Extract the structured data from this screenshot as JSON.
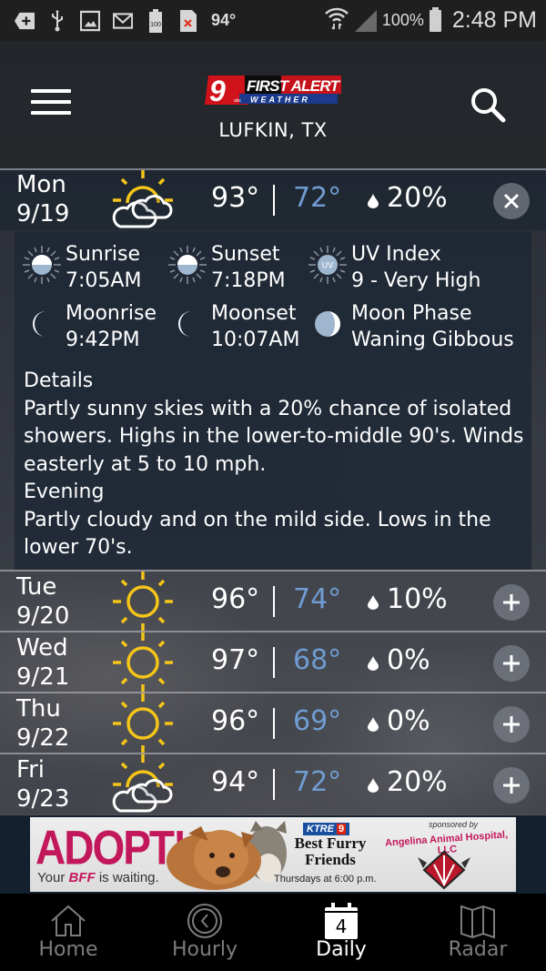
{
  "status_bar": {
    "notification_icons": [
      "add-icon",
      "usb-icon",
      "gallery-icon",
      "gmail-icon",
      "battery-100-icon",
      "sim-error-icon"
    ],
    "temperature": "94°",
    "battery_percent": "100%",
    "time": "2:48 PM"
  },
  "header": {
    "logo": {
      "number": "9",
      "line1": "FIRST ALERT",
      "line2": "WEATHER",
      "network": "abc"
    },
    "location": "LUFKIN, TX",
    "menu_icon": "hamburger-menu-icon",
    "search_icon": "search-icon"
  },
  "colors": {
    "low_temp": "#6f9cd1",
    "sun": "#f5c518",
    "accent_ad": "#c2185b"
  },
  "days": [
    {
      "day": "Mon",
      "date": "9/19",
      "icon": "partly-cloudy-icon",
      "high": "93°",
      "low": "72°",
      "precip": "20%",
      "expanded": true,
      "toggle": "close-icon"
    },
    {
      "day": "Tue",
      "date": "9/20",
      "icon": "sunny-icon",
      "high": "96°",
      "low": "74°",
      "precip": "10%",
      "expanded": false,
      "toggle": "plus-icon"
    },
    {
      "day": "Wed",
      "date": "9/21",
      "icon": "sunny-icon",
      "high": "97°",
      "low": "68°",
      "precip": "0%",
      "expanded": false,
      "toggle": "plus-icon"
    },
    {
      "day": "Thu",
      "date": "9/22",
      "icon": "sunny-icon",
      "high": "96°",
      "low": "69°",
      "precip": "0%",
      "expanded": false,
      "toggle": "plus-icon"
    },
    {
      "day": "Fri",
      "date": "9/23",
      "icon": "partly-cloudy-icon",
      "high": "94°",
      "low": "72°",
      "precip": "20%",
      "expanded": false,
      "toggle": "plus-icon"
    }
  ],
  "details": {
    "astro": [
      {
        "label": "Sunrise",
        "value": "7:05AM",
        "icon": "sunrise-icon"
      },
      {
        "label": "Sunset",
        "value": "7:18PM",
        "icon": "sunset-icon"
      },
      {
        "label": "UV Index",
        "value": "9 - Very High",
        "icon": "uv-index-icon"
      },
      {
        "label": "Moonrise",
        "value": "9:42PM",
        "icon": "moonrise-icon"
      },
      {
        "label": "Moonset",
        "value": "10:07AM",
        "icon": "moonset-icon"
      },
      {
        "label": "Moon Phase",
        "value": "Waning Gibbous",
        "icon": "moon-phase-icon"
      }
    ],
    "uv_badge": "UV",
    "details_heading": "Details",
    "details_text": "Partly sunny skies with a 20% chance of isolated showers.  Highs in the lower-to-middle 90's. Winds easterly at 5 to 10 mph.",
    "evening_heading": "Evening",
    "evening_text": "Partly cloudy and on the mild side.  Lows in the lower 70's."
  },
  "ad": {
    "headline": "ADOPT!",
    "tagline_pre": "Your ",
    "tagline_bff": "BFF",
    "tagline_post": " is waiting.",
    "station": "KTRE",
    "station_num": "9",
    "title_line1": "Best Furry",
    "title_line2": "Friends",
    "schedule": "Thursdays at 6:00 p.m.",
    "sponsor_label": "sponsored by",
    "sponsor": "Angelina Animal Hospital, LLC"
  },
  "bottom_nav": {
    "items": [
      {
        "label": "Home",
        "icon": "home-icon",
        "active": false
      },
      {
        "label": "Hourly",
        "icon": "clock-icon",
        "active": false
      },
      {
        "label": "Daily",
        "icon": "calendar-icon",
        "active": true,
        "badge": "4"
      },
      {
        "label": "Radar",
        "icon": "map-icon",
        "active": false
      }
    ]
  }
}
